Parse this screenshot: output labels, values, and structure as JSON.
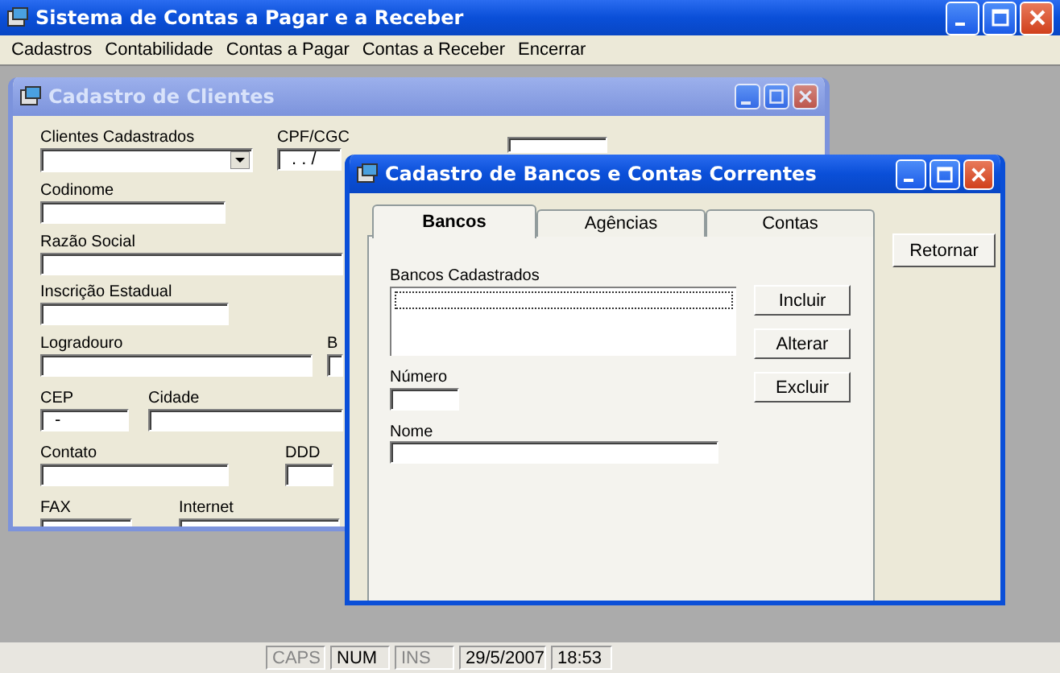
{
  "window": {
    "title": "Sistema de Contas a Pagar e a Receber"
  },
  "menu": [
    "Cadastros",
    "Contabilidade",
    "Contas a Pagar",
    "Contas a Receber",
    "Encerrar"
  ],
  "clientes_window": {
    "title": "Cadastro de Clientes",
    "active": false,
    "fields": [
      {
        "label": "Clientes Cadastrados",
        "kind": "combo"
      },
      {
        "label": "CPF/CGC",
        "kind": "text",
        "value": ". . /"
      },
      {
        "kind": "text"
      },
      {
        "label": "Codinome",
        "kind": "text"
      },
      {
        "label": "Razão Social",
        "kind": "text"
      },
      {
        "label": "Inscrição Estadual",
        "kind": "text"
      },
      {
        "label": "Logradouro",
        "kind": "text"
      },
      {
        "label": "B",
        "kind": "text"
      },
      {
        "label": "CEP",
        "kind": "text",
        "value": "-"
      },
      {
        "label": "Cidade",
        "kind": "text"
      },
      {
        "label": "Contato",
        "kind": "text"
      },
      {
        "label": "DDD",
        "kind": "text"
      },
      {
        "label": "FAX",
        "kind": "text"
      },
      {
        "label": "Internet",
        "kind": "text"
      }
    ]
  },
  "bancos_window": {
    "title": "Cadastro de Bancos e Contas Correntes",
    "active": true,
    "tabs": [
      {
        "label": "Bancos",
        "selected": true
      },
      {
        "label": "Agências",
        "selected": false
      },
      {
        "label": "Contas",
        "selected": false
      }
    ],
    "list_label": "Bancos Cadastrados",
    "buttons": [
      "Incluir",
      "Alterar",
      "Excluir"
    ],
    "fields": [
      {
        "label": "Número"
      },
      {
        "label": "Nome"
      }
    ],
    "return_button": "Retornar"
  },
  "status_bar": [
    {
      "text": "CAPS",
      "on": false
    },
    {
      "text": "NUM",
      "on": true
    },
    {
      "text": "INS",
      "on": false
    },
    {
      "text": "29/5/2007",
      "on": true
    },
    {
      "text": "18:53",
      "on": true
    }
  ]
}
